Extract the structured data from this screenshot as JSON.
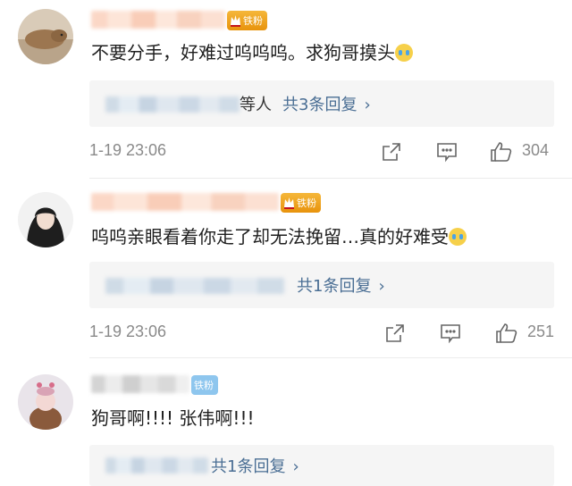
{
  "comments": [
    {
      "badge": "铁粉",
      "text": "不要分手，好难过呜呜呜。求狗哥摸头",
      "reply_tail": "等人",
      "reply_link": "共3条回复",
      "time": "1-19 23:06",
      "likes": "304",
      "icons": [
        "share-icon",
        "comment-icon",
        "like-icon"
      ]
    },
    {
      "badge": "铁粉",
      "text": "呜呜亲眼看着你走了却无法挽留…真的好难受",
      "reply_tail": "",
      "reply_link": "共1条回复",
      "time": "1-19 23:06",
      "likes": "251",
      "icons": [
        "share-icon",
        "comment-icon",
        "like-icon"
      ]
    },
    {
      "badge": "铁粉",
      "text": "狗哥啊!!!! 张伟啊!!!",
      "reply_tail": "",
      "reply_link": "共1条回复",
      "icons": []
    }
  ],
  "colors": {
    "link": "#4a6e94",
    "meta_text": "#8a8a8a",
    "badge_gold": "#e8930c",
    "badge_blue": "#8ec6ee"
  }
}
